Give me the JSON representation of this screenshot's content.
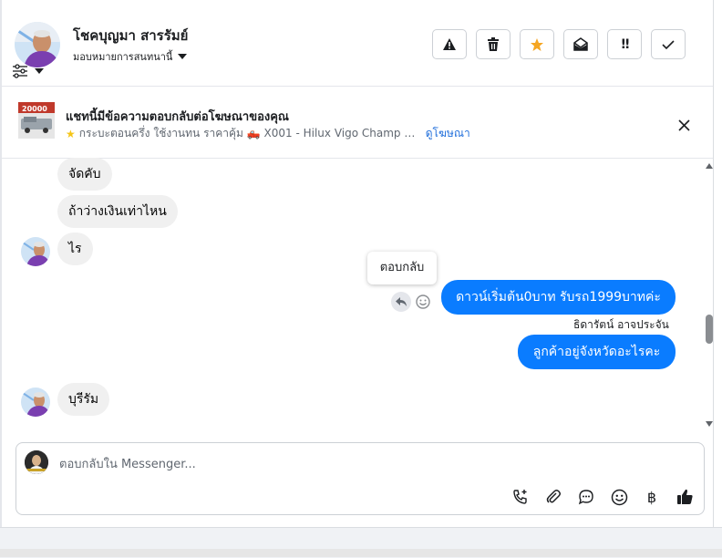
{
  "header": {
    "contact_name": "โชคบุญมา สารรัมย์",
    "assign_label": "มอบหมายการสนทนานี้",
    "actions": [
      {
        "name": "spam-button",
        "icon": "warning-icon"
      },
      {
        "name": "delete-button",
        "icon": "trash-icon"
      },
      {
        "name": "star-button",
        "icon": "star-icon",
        "color": "#f5a623"
      },
      {
        "name": "mark-unread-button",
        "icon": "envelope-open-icon"
      },
      {
        "name": "follow-up-button",
        "icon": "double-exclamation-icon"
      },
      {
        "name": "done-button",
        "icon": "check-icon"
      }
    ]
  },
  "ad": {
    "thumb_text": "20000",
    "title": "แชทนี้มีข้อความตอบกลับต่อโฆษณาของคุณ",
    "description": "กระบะตอนครึ่ง ใช้งานทน ราคาคุ้ม 🛻 X001 - Hilux Vigo Champ Ca...",
    "link": "ดูโฆษณา"
  },
  "messages": {
    "in_1": "จัดคับ",
    "in_2": "ถ้าว่างเงินเท่าไหน",
    "in_3": "ไร",
    "out_1": "ดาวน์เริ่มต้น0บาท รับรถ1999บาทค่ะ",
    "sender": "ธิดารัตน์ อาจประจัน",
    "out_2": "ลูกค้าอยู่จังหวัดอะไรคะ",
    "in_4": "บุรีรัม",
    "tooltip": "ตอบกลับ"
  },
  "composer": {
    "placeholder": "ตอบกลับใน Messenger..."
  },
  "colors": {
    "outgoing_bubble": "#0a7cff",
    "incoming_bubble": "#f0f0f0",
    "link": "#216fdb",
    "star": "#f5a623"
  }
}
